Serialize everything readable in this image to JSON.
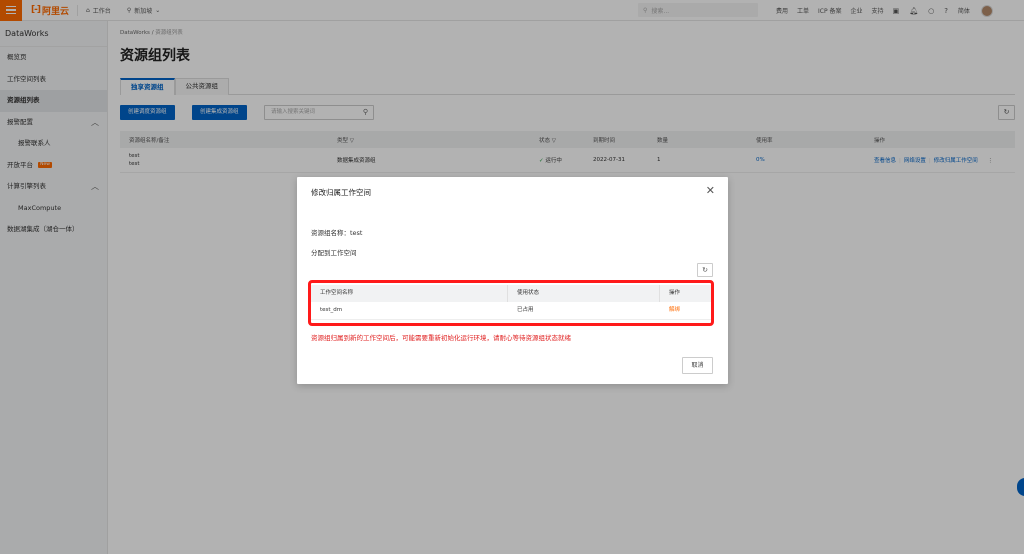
{
  "topbar": {
    "logo_mark": "[-]",
    "logo_text": "阿里云",
    "workbench": "工作台",
    "region": "新加坡",
    "search_placeholder": "搜索...",
    "links": [
      "费用",
      "工单",
      "ICP 备案",
      "企业",
      "支持"
    ],
    "lang": "简体"
  },
  "sidebar": {
    "title": "DataWorks",
    "items": [
      {
        "label": "概览页"
      },
      {
        "label": "工作空间列表"
      },
      {
        "label": "资源组列表"
      },
      {
        "label": "报警配置"
      },
      {
        "label": "报警联系人"
      },
      {
        "label": "开放平台"
      },
      {
        "label": "计算引擎列表"
      },
      {
        "label": "MaxCompute"
      },
      {
        "label": "数据湖集成（湖仓一体）"
      }
    ],
    "new_badge": "New"
  },
  "main": {
    "breadcrumb_root": "DataWorks",
    "breadcrumb_sep": "/",
    "breadcrumb_current": "资源组列表",
    "title": "资源组列表",
    "tabs": [
      "独享资源组",
      "公共资源组"
    ],
    "btn_create_schedule": "创建调度资源组",
    "btn_create_integration": "创建集成资源组",
    "search_placeholder": "请输入搜索关键词",
    "columns": [
      "资源组名称/备注",
      "类型",
      "状态",
      "到期时间",
      "数量",
      "使用率",
      "操作"
    ],
    "row": {
      "name": "test",
      "note": "test",
      "type": "数据集成资源组",
      "status": "运行中",
      "expire": "2022-07-31",
      "count": "1",
      "usage": "0%",
      "ops": [
        "查看信息",
        "网络设置",
        "修改归属工作空间"
      ]
    }
  },
  "modal": {
    "title": "修改归属工作空间",
    "name_line": "资源组名称：test",
    "assign_label": "分配到工作空间",
    "table_headers": [
      "工作空间名称",
      "使用状态",
      "操作"
    ],
    "table_row": {
      "workspace": "test_dm",
      "state": "已占用",
      "action": "解绑"
    },
    "warning": "资源组归属到新的工作空间后，可能需要重新初始化运行环境，请耐心等待资源组状态就绪",
    "cancel": "取消"
  }
}
